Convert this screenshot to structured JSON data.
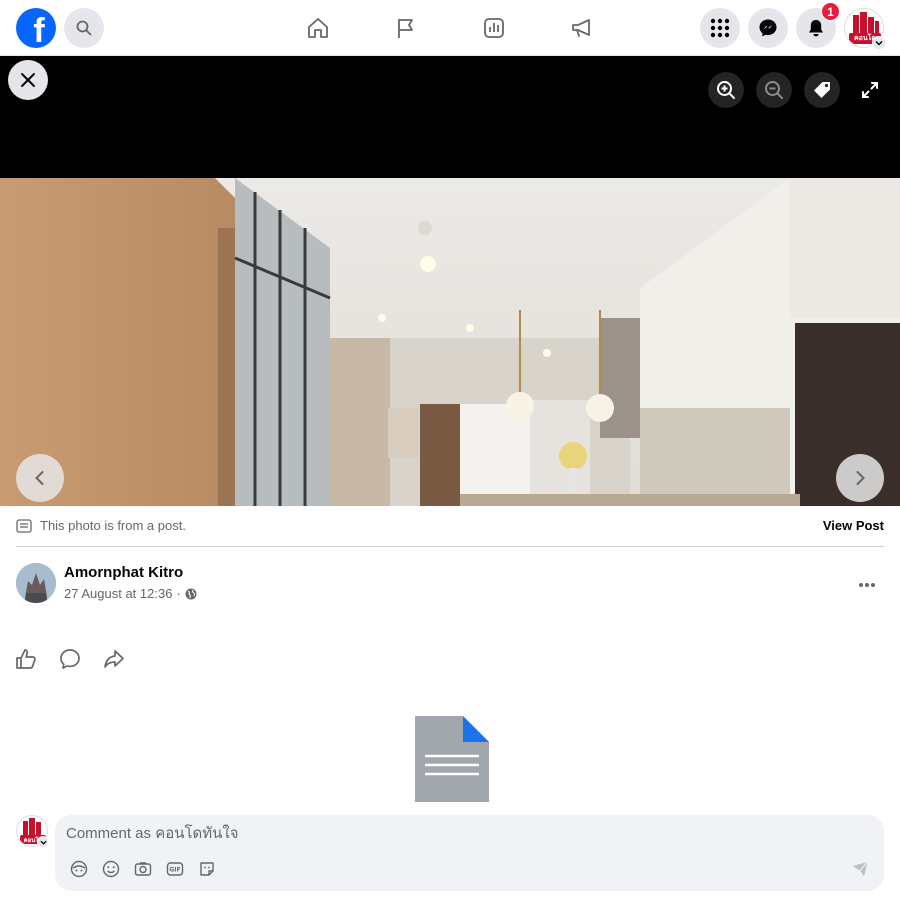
{
  "topbar": {
    "logo_letter": "f",
    "notification_count": "1",
    "page_avatar_text": "คอนโด"
  },
  "post": {
    "from_post_text": "This photo is from a post.",
    "view_post_label": "View Post",
    "author_name": "Amornphat Kitro",
    "timestamp": "27 August at 12:36",
    "separator": "·"
  },
  "comment": {
    "placeholder": "Comment as คอนโดทันใจ",
    "commenter_avatar_text": "คอนโด"
  },
  "colors": {
    "brand": "#0866ff",
    "badge": "#e41e3f",
    "icon": "#65676b"
  },
  "icons": [
    "facebook-logo",
    "search-icon",
    "home-icon",
    "flag-icon",
    "chart-icon",
    "megaphone-icon",
    "menu-grid-icon",
    "messenger-icon",
    "bell-icon",
    "close-icon",
    "zoom-in-icon",
    "zoom-out-icon",
    "tag-icon",
    "fullscreen-icon",
    "chevron-left-icon",
    "chevron-right-icon",
    "post-icon",
    "globe-icon",
    "more-icon",
    "like-icon",
    "comment-icon",
    "share-icon",
    "document-icon",
    "avatar-frame-icon",
    "emoji-icon",
    "camera-icon",
    "gif-icon",
    "sticker-icon",
    "send-icon"
  ]
}
